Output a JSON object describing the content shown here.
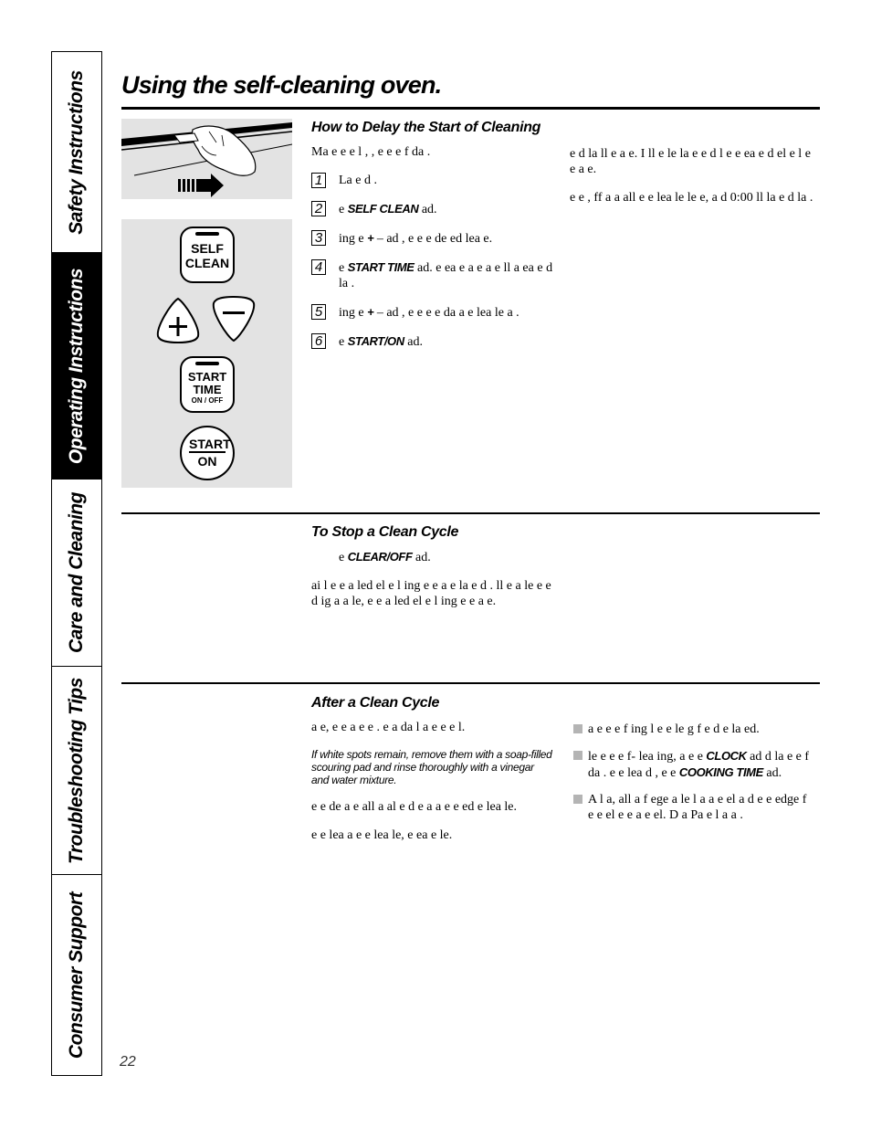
{
  "side_tabs": [
    {
      "label": "Safety Instructions",
      "active": false
    },
    {
      "label": "Operating Instructions",
      "active": true
    },
    {
      "label": "Care and Cleaning",
      "active": false
    },
    {
      "label": "Troubleshooting Tips",
      "active": false
    },
    {
      "label": "Consumer Support",
      "active": false
    }
  ],
  "page_title": "Using the self-cleaning oven.",
  "illustration": {
    "self_clean_button": {
      "line1": "SELF",
      "line2": "CLEAN"
    },
    "plus_button": "+",
    "minus_button": "–",
    "start_time_button": {
      "line1": "START",
      "line2": "TIME",
      "line3": "ON / OFF"
    },
    "start_on_button": {
      "line1": "START",
      "line2": "ON"
    }
  },
  "delay_section": {
    "heading": "How to Delay the Start of Cleaning",
    "intro": "Ma e  e  e l  ,   ,  e  e  e  f da .",
    "steps": [
      {
        "num": "1",
        "text_before": "La   e d  .",
        "keyword": "",
        "text_after": ""
      },
      {
        "num": "2",
        "text_before": "  e ",
        "keyword": "SELF CLEAN",
        "text_after": " ad."
      },
      {
        "num": "3",
        "text_before": " ing  e ",
        "keyword": "+",
        "text_after": "  –  ad , e  e  e de  ed  lea  e."
      },
      {
        "num": "4",
        "text_before": "  e ",
        "keyword": "START TIME",
        "text_after": " ad.  e ea  e  a  e  a  e  ll a  ea   e d  la ."
      },
      {
        "num": "5",
        "text_before": " ing  e ",
        "keyword": "+",
        "text_after": "  –  ad , e  e  e  e  da   a   e  lea   le  a ."
      },
      {
        "num": "6",
        "text_before": "  e ",
        "keyword": "START/ON",
        "text_after": " ad."
      }
    ],
    "right_paragraphs": [
      " e d  la  ll    e  a  e. I  ll   e  le  la   e  e d   l  e e  ea  e d  el  e l  e  e a  e.",
      " e  e  ,   ff a   a  all  e  e  lea  le   le e, a d 0:00  ll  la   e d  la ."
    ]
  },
  "stop_section": {
    "heading": "To Stop a Clean Cycle",
    "lead_before": "  e ",
    "lead_keyword": "CLEAR/OFF",
    "lead_after": " ad.",
    "paragraph": "ai  l  e  e  a   led el  e l  ing e  e a  e  la   e d  .  ll  e a le  e  e d  ig  a a  le,  e  e  a  led el  e l  ing e  e a  e."
  },
  "after_section": {
    "heading": "After a Clean Cycle",
    "left_paragraphs": [
      " a    e,  e   e a    e  e .   e     a da   l   a  e  e  e   l.",
      " e e de   a e   all a al e d e  a  a   e  e  ed  e  lea  le.",
      " e  e    lea  a e   e  lea  le, e ea  e  le."
    ],
    "note": "If white spots remain, remove them with a soap-filled scouring pad and rinse thoroughly with a vinegar and water mixture.",
    "bullets": [
      {
        "text_before": " a   e  e  e f   ing  l  e  e   le  g f   e d   e  la  ed.",
        "keyword1": "",
        "text_mid": "",
        "keyword2": "",
        "text_after": ""
      },
      {
        "text_before": " le  e  e  e f- lea ing,  a  e  e ",
        "keyword1": "CLOCK",
        "text_mid": " ad  d  la  e  e f da .  e    e lea   d  ,  e  e ",
        "keyword2": "COOKING TIME",
        "text_after": " ad."
      },
      {
        "text_before": "A  l  a,  all a   f  ege a le  l  a a e   el a d   e  e edge  f  e  e  el e    e a e  el. D   a   Pa    e l  a   a .",
        "keyword1": "",
        "text_mid": "",
        "keyword2": "",
        "text_after": ""
      }
    ]
  },
  "page_number": "22"
}
